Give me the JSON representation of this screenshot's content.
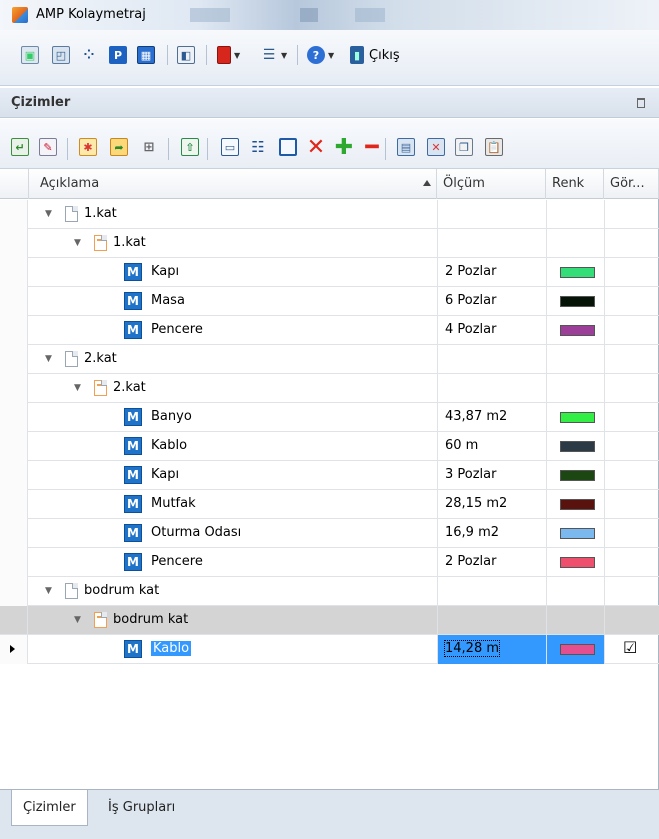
{
  "window": {
    "title": "AMP Kolaymetraj"
  },
  "toolbar": {
    "exit_label": "Çıkış",
    "icons": [
      "save-icon",
      "open-folder-icon",
      "grid-icon",
      "p-icon",
      "table-icon",
      "window-icon",
      "red-book-icon",
      "list-dropdown-icon",
      "help-icon",
      "exit-door-icon"
    ]
  },
  "panel": {
    "title": "Çizimler",
    "toolbar_icons": [
      "import-icon",
      "edit-icon",
      "new-folder-icon",
      "open-folder-icon",
      "tree-icon",
      "export-icon",
      "window-icon",
      "list-icon",
      "copy-window-icon",
      "delete-icon",
      "add-icon",
      "remove-icon",
      "print-icon",
      "print-delete-icon",
      "copy-icon",
      "paste-icon"
    ]
  },
  "grid": {
    "columns": [
      "Açıklama",
      "Ölçüm",
      "Renk",
      "Gör..."
    ],
    "rows": [
      {
        "level": 0,
        "type": "doc",
        "label": "1.kat",
        "measure": "",
        "color": ""
      },
      {
        "level": 1,
        "type": "folder",
        "label": "1.kat",
        "measure": "",
        "color": ""
      },
      {
        "level": 2,
        "type": "m",
        "label": "Kapı",
        "measure": "2 Pozlar",
        "color": "#33dd77"
      },
      {
        "level": 2,
        "type": "m",
        "label": "Masa",
        "measure": "6 Pozlar",
        "color": "#061408"
      },
      {
        "level": 2,
        "type": "m",
        "label": "Pencere",
        "measure": "4 Pozlar",
        "color": "#9c3f99"
      },
      {
        "level": 0,
        "type": "doc",
        "label": "2.kat",
        "measure": "",
        "color": ""
      },
      {
        "level": 1,
        "type": "folder",
        "label": "2.kat",
        "measure": "",
        "color": ""
      },
      {
        "level": 2,
        "type": "m",
        "label": "Banyo",
        "measure": "43,87 m2",
        "color": "#33ee44"
      },
      {
        "level": 2,
        "type": "m",
        "label": "Kablo",
        "measure": "60 m",
        "color": "#2b3a44"
      },
      {
        "level": 2,
        "type": "m",
        "label": "Kapı",
        "measure": "3 Pozlar",
        "color": "#1c4713"
      },
      {
        "level": 2,
        "type": "m",
        "label": "Mutfak",
        "measure": "28,15 m2",
        "color": "#5a120e"
      },
      {
        "level": 2,
        "type": "m",
        "label": "Oturma Odası",
        "measure": "16,9 m2",
        "color": "#7ab8ee"
      },
      {
        "level": 2,
        "type": "m",
        "label": "Pencere",
        "measure": "2 Pozlar",
        "color": "#ee4f6c"
      },
      {
        "level": 0,
        "type": "doc",
        "label": "bodrum kat",
        "measure": "",
        "color": ""
      },
      {
        "level": 1,
        "type": "folder",
        "label": "bodrum kat",
        "measure": "",
        "color": "",
        "highlight": true
      },
      {
        "level": 2,
        "type": "m",
        "label": "Kablo",
        "measure": "14,28 m",
        "color": "#e34f8f",
        "selected": true,
        "visible": true
      }
    ]
  },
  "bottom_tabs": [
    "Çizimler",
    "İş Grupları"
  ]
}
